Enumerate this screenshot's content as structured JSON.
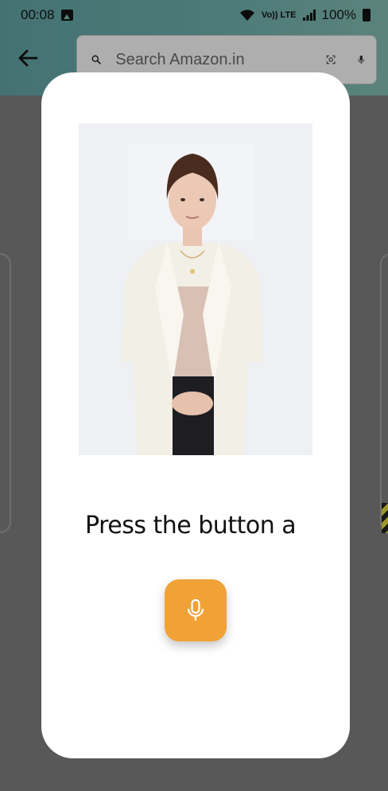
{
  "status_bar": {
    "time": "00:08",
    "network_label": "Vo)) LTE",
    "battery": "100%"
  },
  "header": {
    "search_placeholder": "Search Amazon.in"
  },
  "modal": {
    "prompt_text": "Press the button a",
    "mic_button_icon": "microphone-icon"
  },
  "colors": {
    "header_start": "#5f9fa0",
    "header_end": "#7fb6ae",
    "mic_button": "#f0a237",
    "modal_bg": "#ffffff"
  }
}
